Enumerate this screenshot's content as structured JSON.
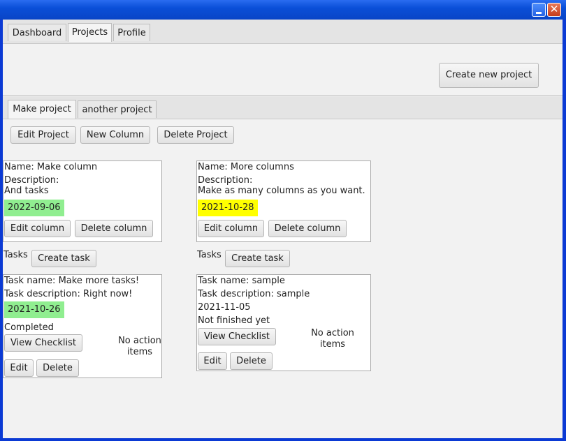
{
  "window": {
    "close_glyph": "✕"
  },
  "main_tabs": [
    "Dashboard",
    "Projects",
    "Profile"
  ],
  "create_project_label": "Create new project",
  "project_tabs": [
    "Make project",
    "another project"
  ],
  "project_toolbar": {
    "edit": "Edit Project",
    "new_column": "New Column",
    "delete": "Delete Project"
  },
  "columns": [
    {
      "name": "Name: Make column",
      "description_label": "Description:",
      "description": "And tasks",
      "date": "2022-09-06",
      "date_color": "#90ee90",
      "edit": "Edit column",
      "delete": "Delete column",
      "tasks_label": "Tasks",
      "create_task": "Create task",
      "task": {
        "name": "Task name: Make more tasks!",
        "description": "Task description: Right now!",
        "date": "2021-10-26",
        "status": "Completed",
        "view_checklist": "View Checklist",
        "no_action_1": "No action",
        "no_action_2": "items",
        "edit": "Edit",
        "delete": "Delete"
      }
    },
    {
      "name": "Name: More columns",
      "description_label": "Description:",
      "description": "Make as many columns as you want.",
      "date": "2021-10-28",
      "date_color": "#ffff00",
      "edit": "Edit column",
      "delete": "Delete column",
      "tasks_label": "Tasks",
      "create_task": "Create task",
      "task": {
        "name": "Task name: sample",
        "description": "Task description: sample",
        "date": "2021-11-05",
        "status": "Not finished yet",
        "view_checklist": "View Checklist",
        "no_action_1": "No action",
        "no_action_2": "items",
        "edit": "Edit",
        "delete": "Delete"
      }
    }
  ]
}
